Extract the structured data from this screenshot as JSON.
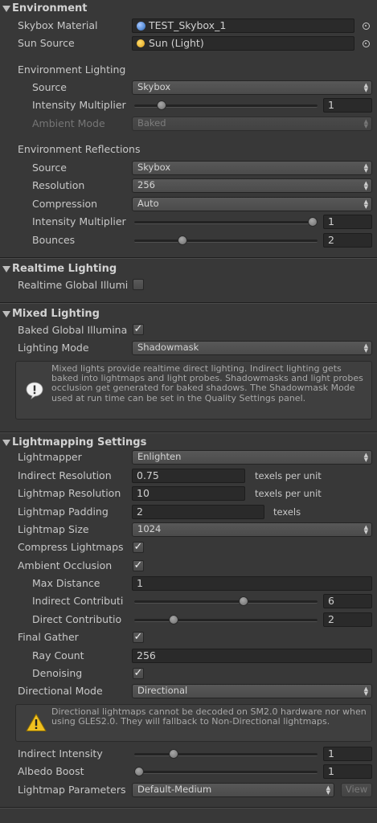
{
  "environment": {
    "header": "Environment",
    "skybox_material_label": "Skybox Material",
    "skybox_material_value": "TEST_Skybox_1",
    "sun_source_label": "Sun Source",
    "sun_source_value": "Sun (Light)",
    "lighting_title": "Environment Lighting",
    "source_label": "Source",
    "source_value": "Skybox",
    "intensity_label": "Intensity Multiplier",
    "intensity_value": "1",
    "intensity_slider_fraction": 0.13,
    "ambient_mode_label": "Ambient Mode",
    "ambient_mode_value": "Baked",
    "reflections_title": "Environment Reflections",
    "refl_source_label": "Source",
    "refl_source_value": "Skybox",
    "resolution_label": "Resolution",
    "resolution_value": "256",
    "compression_label": "Compression",
    "compression_value": "Auto",
    "refl_intensity_label": "Intensity Multiplier",
    "refl_intensity_value": "1",
    "refl_intensity_slider_fraction": 1.0,
    "bounces_label": "Bounces",
    "bounces_value": "2",
    "bounces_slider_fraction": 0.25
  },
  "realtime": {
    "header": "Realtime Lighting",
    "rtgi_label": "Realtime Global Illumi",
    "rtgi_checked": false
  },
  "mixed": {
    "header": "Mixed Lighting",
    "bakedgi_label": "Baked Global Illumina",
    "bakedgi_checked": true,
    "mode_label": "Lighting Mode",
    "mode_value": "Shadowmask",
    "help_text": "Mixed lights provide realtime direct lighting. Indirect lighting gets baked into lightmaps and light probes. Shadowmasks and light probes occlusion get generated for baked shadows. The Shadowmask Mode used at run time can be set in the Quality Settings panel."
  },
  "lightmapping": {
    "header": "Lightmapping Settings",
    "lightmapper_label": "Lightmapper",
    "lightmapper_value": "Enlighten",
    "indirect_res_label": "Indirect Resolution",
    "indirect_res_value": "0.75",
    "indirect_res_unit": "texels per unit",
    "lightmap_res_label": "Lightmap Resolution",
    "lightmap_res_value": "10",
    "lightmap_res_unit": "texels per unit",
    "padding_label": "Lightmap Padding",
    "padding_value": "2",
    "padding_unit": "texels",
    "size_label": "Lightmap Size",
    "size_value": "1024",
    "compress_label": "Compress Lightmaps",
    "compress_checked": true,
    "ao_label": "Ambient Occlusion",
    "ao_checked": true,
    "max_distance_label": "Max Distance",
    "max_distance_value": "1",
    "indirect_contrib_label": "Indirect Contributi",
    "indirect_contrib_value": "6",
    "indirect_contrib_fraction": 0.6,
    "direct_contrib_label": "Direct Contributio",
    "direct_contrib_value": "2",
    "direct_contrib_fraction": 0.2,
    "final_gather_label": "Final Gather",
    "final_gather_checked": true,
    "ray_count_label": "Ray Count",
    "ray_count_value": "256",
    "denoising_label": "Denoising",
    "denoising_checked": true,
    "directional_mode_label": "Directional Mode",
    "directional_mode_value": "Directional",
    "warn_text": "Directional lightmaps cannot be decoded on SM2.0 hardware nor when using GLES2.0. They will fallback to Non-Directional lightmaps.",
    "indirect_intensity_label": "Indirect Intensity",
    "indirect_intensity_value": "1",
    "indirect_intensity_fraction": 0.2,
    "albedo_boost_label": "Albedo Boost",
    "albedo_boost_value": "1",
    "albedo_boost_fraction": 0.0,
    "params_label": "Lightmap Parameters",
    "params_value": "Default-Medium",
    "view_label": "View"
  },
  "colors": {
    "panel_bg": "#383838",
    "skybox_icon": "#5a8fd8",
    "sun_icon": "#e8b030",
    "warning_icon": "#f0c020"
  }
}
